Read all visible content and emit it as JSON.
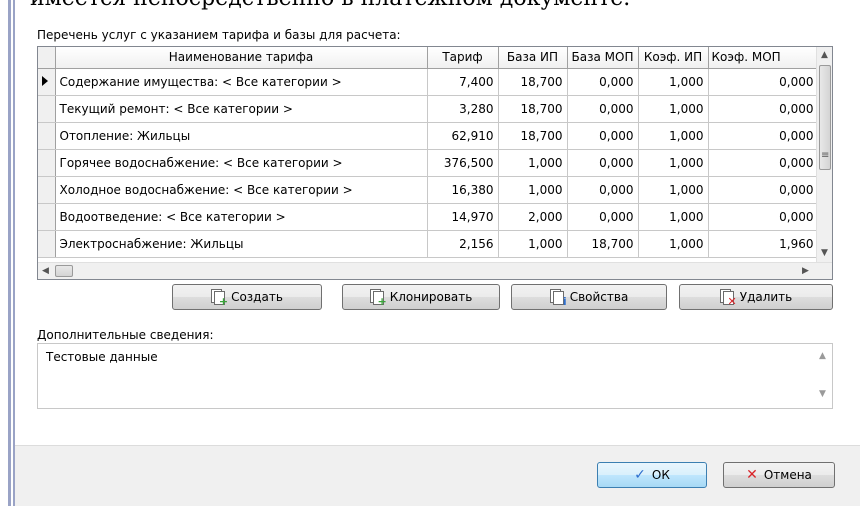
{
  "background_text": "имеется непосредственно в платежном документе.",
  "services_caption": "Перечень услуг с указанием тарифа и базы для расчета:",
  "table": {
    "columns": [
      "Наименование тарифа",
      "Тариф",
      "База ИП",
      "База МОП",
      "Коэф. ИП",
      "Коэф. МОП"
    ],
    "rows": [
      [
        "Содержание имущества: < Все категории >",
        "7,400",
        "18,700",
        "0,000",
        "1,000",
        "0,000"
      ],
      [
        "Текущий ремонт: < Все категории >",
        "3,280",
        "18,700",
        "0,000",
        "1,000",
        "0,000"
      ],
      [
        "Отопление: Жильцы",
        "62,910",
        "18,700",
        "0,000",
        "1,000",
        "0,000"
      ],
      [
        "Горячее водоснабжение: < Все категории >",
        "376,500",
        "1,000",
        "0,000",
        "1,000",
        "0,000"
      ],
      [
        "Холодное водоснабжение: < Все категории >",
        "16,380",
        "1,000",
        "0,000",
        "1,000",
        "0,000"
      ],
      [
        "Водоотведение: < Все категории >",
        "14,970",
        "2,000",
        "0,000",
        "1,000",
        "0,000"
      ],
      [
        "Электроснабжение: Жильцы",
        "2,156",
        "1,000",
        "18,700",
        "1,000",
        "1,960"
      ]
    ]
  },
  "buttons": {
    "create": "Создать",
    "clone": "Клонировать",
    "properties": "Свойства",
    "delete": "Удалить",
    "ok": "ОК",
    "cancel": "Отмена"
  },
  "icons": {
    "create": "+",
    "clone": "+",
    "properties": "i",
    "delete": "✕",
    "ok": "✓",
    "cancel": "✕"
  },
  "extra_caption": "Дополнительные сведения:",
  "extra_text": "Тестовые данные",
  "colors": {
    "add_green": "#3aa53a",
    "delete_red": "#d9262b",
    "info_blue": "#2f6fce",
    "ok_border": "#3c7fb1"
  }
}
